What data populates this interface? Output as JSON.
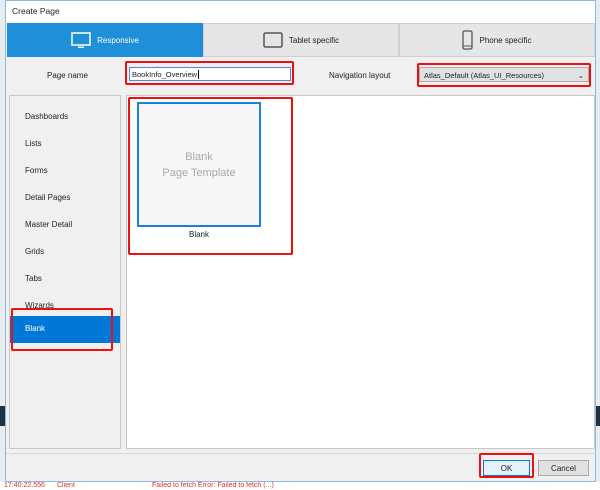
{
  "dialog": {
    "title": "Create Page",
    "tabs": [
      {
        "label": "Responsive",
        "icon": "monitor-icon",
        "active": true
      },
      {
        "label": "Tablet specific",
        "icon": "tablet-icon",
        "active": false
      },
      {
        "label": "Phone specific",
        "icon": "phone-icon",
        "active": false
      }
    ],
    "page_name_label": "Page name",
    "page_name_value": "BookInfo_Overview",
    "nav_layout_label": "Navigation layout",
    "nav_layout_value": "Atlas_Default (Atlas_UI_Resources)",
    "categories": [
      "Dashboards",
      "Lists",
      "Forms",
      "Detail Pages",
      "Master Detail",
      "Grids",
      "Tabs",
      "Wizards",
      "Blank"
    ],
    "selected_category": "Blank",
    "template": {
      "preview_line1": "Blank",
      "preview_line2": "Page Template",
      "label": "Blank"
    },
    "ok_label": "OK",
    "cancel_label": "Cancel"
  },
  "background_log": {
    "time": "17:40:22.556",
    "source": "Client",
    "message": "Failed to fetch Error: Failed to fetch (...)"
  },
  "colors": {
    "accent": "#1e8fd8",
    "selection": "#0078d7",
    "highlight": "#ee1010"
  }
}
